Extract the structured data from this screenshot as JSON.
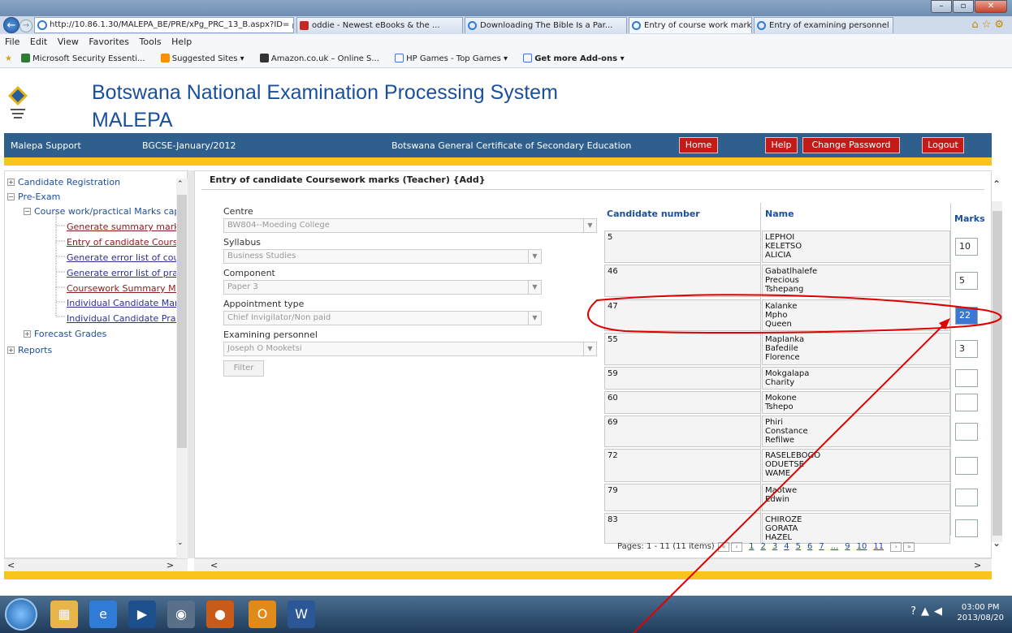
{
  "browser": {
    "address": "http://10.86.1.30/MALEPA_BE/PRE/xPg_PRC_13_B.aspx?ID=",
    "tabs": [
      {
        "label": "oddie - Newest eBooks & the ..."
      },
      {
        "label": "Downloading The Bible Is a Par..."
      },
      {
        "label": "Entry of course work marks",
        "close": "×"
      },
      {
        "label": "Entry of examining personnel"
      }
    ],
    "menu": [
      "File",
      "Edit",
      "View",
      "Favorites",
      "Tools",
      "Help"
    ],
    "favorites": [
      "Microsoft Security Essenti...",
      "Suggested Sites ▾",
      "Amazon.co.uk – Online S...",
      "HP Games - Top Games ▾",
      "Get more Add-ons ▾"
    ]
  },
  "header": {
    "title": "Botswana National Examination Processing System",
    "subtitle": "MALEPA"
  },
  "nav": {
    "support": "Malepa Support",
    "session": "BGCSE-January/2012",
    "qualification": "Botswana General Certificate of Secondary Education",
    "home": "Home",
    "help": "Help",
    "change_password": "Change Password",
    "logout": "Logout"
  },
  "tree": {
    "candidate_registration": "Candidate Registration",
    "pre_exam": "Pre-Exam",
    "coursework": "Course work/practical Marks capt",
    "items": [
      "Generate summary mark she",
      "Entry of candidate Coursewo",
      "Generate error list of coursev",
      "Generate error list of practica",
      "Coursework Summary Marksh",
      "Individual Candidate Markshe",
      "Individual Candidate Practical"
    ],
    "forecast": "Forecast Grades",
    "reports": "Reports"
  },
  "form": {
    "panel_title": "Entry of candidate Coursework marks (Teacher) {Add}",
    "centre_label": "Centre",
    "centre_value": "BW804--Moeding College",
    "syllabus_label": "Syllabus",
    "syllabus_value": "Business Studies",
    "component_label": "Component",
    "component_value": "Paper 3",
    "appointment_label": "Appointment type",
    "appointment_value": "Chief Invigilator/Non paid",
    "personnel_label": "Examining personnel",
    "personnel_value": "Joseph O Mooketsi",
    "filter": "Filter"
  },
  "grid": {
    "headers": {
      "candidate": "Candidate number",
      "name": "Name",
      "marks": "Marks"
    },
    "rows": [
      {
        "number": "5",
        "name": "LEPHOI\nKELETSO\nALICIA",
        "mark": "10"
      },
      {
        "number": "46",
        "name": "Gabatlhalefe\nPrecious\nTshepang",
        "mark": "5"
      },
      {
        "number": "47",
        "name": "Kalanke\nMpho\nQueen",
        "mark": "22"
      },
      {
        "number": "55",
        "name": "Maplanka\nBafedile\nFlorence",
        "mark": "3"
      },
      {
        "number": "59",
        "name": "Mokgalapa\nCharity",
        "mark": ""
      },
      {
        "number": "60",
        "name": "Mokone\nTshepo",
        "mark": ""
      },
      {
        "number": "69",
        "name": "Phiri\nConstance\nRefilwe",
        "mark": ""
      },
      {
        "number": "72",
        "name": "RASELEBOGO\nODUETSE\nWAME",
        "mark": ""
      },
      {
        "number": "79",
        "name": "Maotwe\nEdwin",
        "mark": ""
      },
      {
        "number": "83",
        "name": "CHIROZE\nGORATA\nHAZEL",
        "mark": ""
      }
    ],
    "pager_text": "Pages: 1 - 11 (11 items)",
    "pages": [
      "1",
      "2",
      "3",
      "4",
      "5",
      "6",
      "7",
      "...",
      "9",
      "10",
      "11"
    ]
  },
  "taskbar": {
    "time": "03:00 PM",
    "date": "2013/08/20"
  },
  "colors": {
    "title_blue": "#1b4f9c",
    "nav_bar": "#2f5f8c",
    "accent_yellow": "#f8c61b",
    "nav_button_red": "#c51a1a",
    "annotation_red": "#e00000"
  }
}
